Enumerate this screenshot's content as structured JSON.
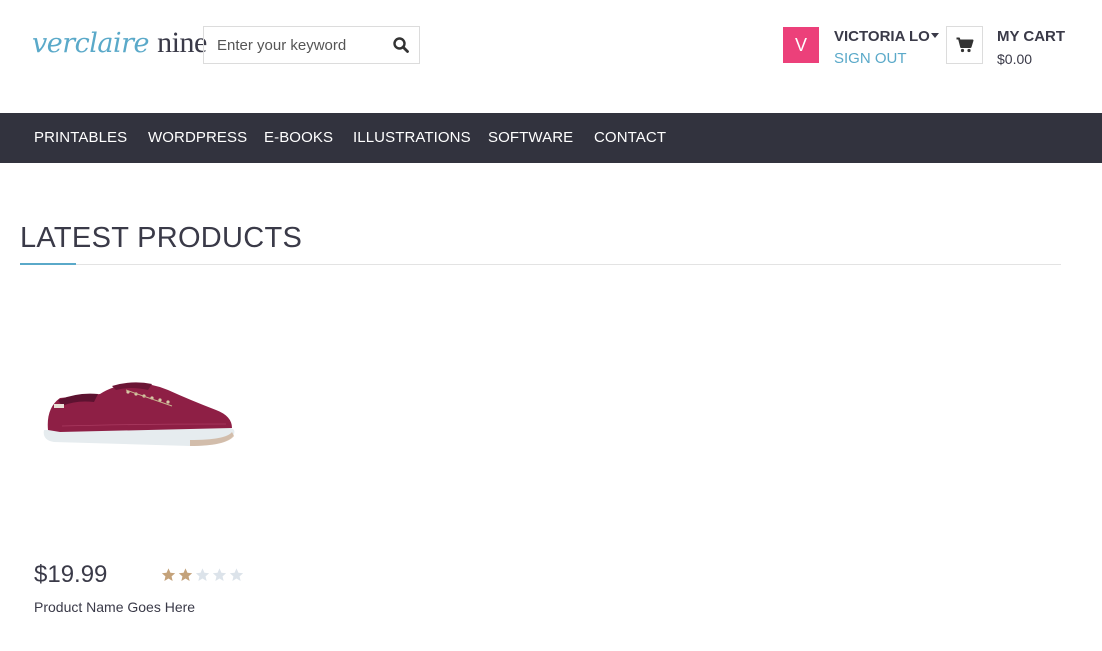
{
  "brand": {
    "logo_part1": "verclaire ",
    "logo_part2": "nine"
  },
  "search": {
    "placeholder": "Enter your keyword",
    "icon": "search-icon"
  },
  "user": {
    "avatar_letter": "V",
    "avatar_color": "#ec407a",
    "name": "VICTORIA LO",
    "sign_out": "SIGN OUT"
  },
  "cart": {
    "title": "MY CART",
    "amount": "$0.00",
    "icon": "shopping-cart-icon"
  },
  "nav": {
    "items": [
      "PRINTABLES",
      "WORDPRESS",
      "E-BOOKS",
      "ILLUSTRATIONS",
      "SOFTWARE",
      "CONTACT"
    ]
  },
  "section": {
    "title": "LATEST PRODUCTS"
  },
  "product": {
    "price": "$19.99",
    "name": "Product Name Goes Here",
    "rating": 2,
    "rating_max": 5,
    "image": "red-sneaker"
  },
  "colors": {
    "accent": "#5aa9c9",
    "nav_bg": "#32333e",
    "star_filled": "#c4a27a",
    "star_empty": "#dce3ea"
  }
}
